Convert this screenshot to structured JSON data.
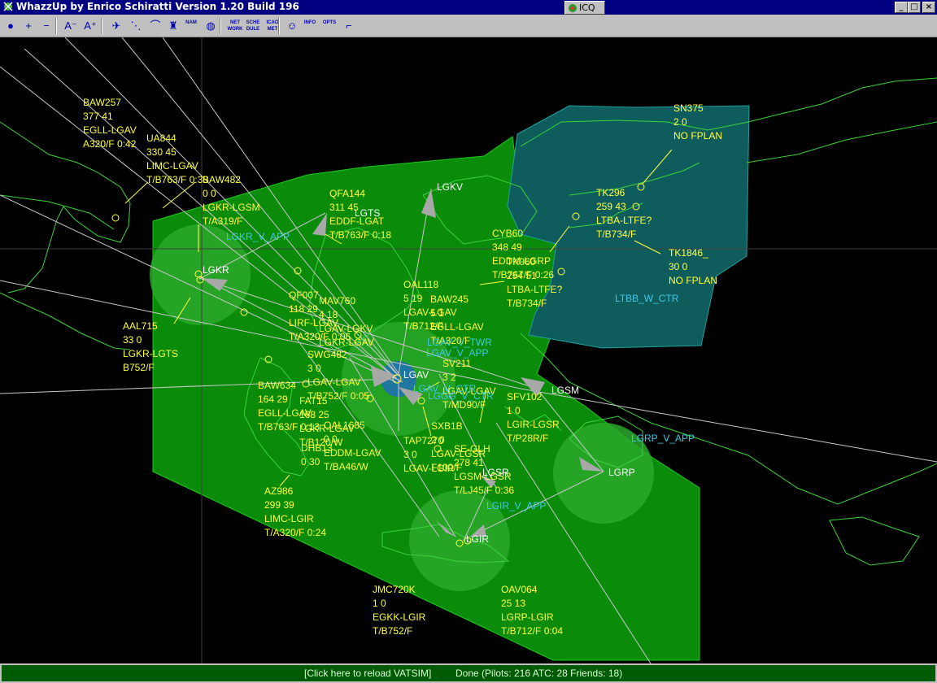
{
  "window": {
    "title": "WhazzUp by Enrico Schiratti Version 1.20 Build 196",
    "icq_label": "ICQ"
  },
  "toolbar": {
    "buttons": [
      {
        "name": "globe-icon",
        "glyph": "●"
      },
      {
        "name": "zoom-in-icon",
        "glyph": "+"
      },
      {
        "name": "zoom-out-icon",
        "glyph": "−"
      },
      {
        "name": "font-smaller-icon",
        "glyph": "A⁻"
      },
      {
        "name": "font-larger-icon",
        "glyph": "A⁺"
      },
      {
        "name": "aircraft-icon",
        "glyph": "✈"
      },
      {
        "name": "dotted-path-icon",
        "glyph": "⋱"
      },
      {
        "name": "route-line-icon",
        "glyph": "⌒"
      },
      {
        "name": "tower-icon",
        "glyph": "♜"
      },
      {
        "name": "nam-label",
        "glyph": "NAM"
      },
      {
        "name": "world-icon",
        "glyph": "◍"
      },
      {
        "name": "network-button",
        "glyph": "NET WORK"
      },
      {
        "name": "schedule-button",
        "glyph": "SCHE DULE"
      },
      {
        "name": "icao-met-button",
        "glyph": "ICAO MET"
      },
      {
        "name": "friends-smiley-icon",
        "glyph": "☺"
      },
      {
        "name": "info-button",
        "glyph": "INFO"
      },
      {
        "name": "options-button",
        "glyph": "OPTS"
      },
      {
        "name": "measure-tool-icon",
        "glyph": "⌐"
      }
    ]
  },
  "flights": [
    {
      "lines": [
        "BAW257",
        "377 41",
        "EGLL-LGAV",
        "A320/F 0:42"
      ]
    },
    {
      "lines": [
        "UA844",
        "330 45",
        "LIMC-LGAV",
        "T/B763/F 0:30"
      ]
    },
    {
      "lines": [
        "BAW482",
        "0 0",
        "LGKR-LGSM",
        "T/A319/F"
      ]
    },
    {
      "lines": [
        "QFA144",
        "311 45",
        "EDDF-LGAT",
        "T/B763/F 0:18"
      ]
    },
    {
      "lines": [
        "SN375",
        "2 0",
        "NO FPLAN"
      ]
    },
    {
      "lines": [
        "TK296",
        "259 43",
        "LTBA-LTFE?",
        "T/B734/F"
      ]
    },
    {
      "lines": [
        "TK1846_",
        "30 0",
        "NO FPLAN"
      ]
    },
    {
      "lines": [
        "CYB60",
        "348 49",
        "EDDM-LGRP",
        "T/B767/F 0:26"
      ]
    },
    {
      "lines": [
        "TK060",
        "254 51",
        "LTBA-LTFE?",
        "T/B734/F"
      ]
    },
    {
      "lines": [
        "OAL118",
        "5 19",
        "LGAV-LGAV",
        "T/B712/F"
      ]
    },
    {
      "lines": [
        "BAW245",
        "5 1",
        "EGLL-LGAV",
        "T/A320/F"
      ]
    },
    {
      "lines": [
        "QF007",
        "118 29",
        "LIRF-LGAV",
        "T/A320/F 0:06"
      ]
    },
    {
      "lines": [
        "MAV760",
        "4 18",
        "LGAV-LGKV",
        "LGKR-LGAV"
      ]
    },
    {
      "lines": [
        "SWG482",
        "3 0",
        "LGAV-LGAV",
        "T/B752/F 0:05"
      ]
    },
    {
      "lines": [
        "AAL715",
        "33 0",
        "LGKR-LGTS",
        "B752/F"
      ]
    },
    {
      "lines": [
        "BAW634",
        "164 29",
        "EGLL-LGAV",
        "T/B763/F 0:13"
      ]
    },
    {
      "lines": [
        "FAT15",
        "168 25",
        "LGKR-LGAV",
        "T/B120/W"
      ]
    },
    {
      "lines": [
        "OAL1685",
        "0 0",
        "EDDM-LGAV",
        "T/BA46/W"
      ]
    },
    {
      "lines": [
        "DHB13",
        "0 30"
      ]
    },
    {
      "lines": [
        "SV211",
        "3 2",
        "LGAV-LGAV",
        "T/MD90/F"
      ]
    },
    {
      "lines": [
        "SFV102",
        "1 0",
        "LGIR-LGSR",
        "T/P28R/F"
      ]
    },
    {
      "lines": [
        "SXB1B",
        "2 0",
        "LGAV-LGSR",
        "F100/F"
      ]
    },
    {
      "lines": [
        "TAP7270",
        "3 0",
        "LGAV-LGIR"
      ]
    },
    {
      "lines": [
        "SE-GLH",
        "278 41",
        "LGSM-LGSR",
        "T/LJ45/F 0:36"
      ]
    },
    {
      "lines": [
        "AZ986",
        "299 39",
        "LIMC-LGIR",
        "T/A320/F 0:24"
      ]
    },
    {
      "lines": [
        "JMC720K",
        "1 0",
        "EGKK-LGIR",
        "T/B752/F"
      ]
    },
    {
      "lines": [
        "OAV064",
        "25 13",
        "LGRP-LGIR",
        "T/B712/F 0:04"
      ]
    }
  ],
  "airports": [
    "LGKV",
    "LGTS",
    "LGKR",
    "LGAV",
    "LGSM",
    "LGSR",
    "LGRP",
    "LGIR"
  ],
  "atc": [
    "LGKR_V_APP",
    "LTBB_W_CTR",
    "LGAV_V_TWR",
    "LGAV_V_APP",
    "LGAV_V_CTR",
    "LGGG_V_CTR",
    "LGRP_V_APP",
    "LGIR_V_APP"
  ],
  "statusbar": {
    "reload": "[Click here to reload VATSIM]",
    "status": "Done (Pilots: 216  ATC: 28  Friends: 18)"
  },
  "colors": {
    "background": "#000000",
    "coast": "#3cd23c",
    "ctr_sector": "#0a8c0a",
    "approach": "#2aa82a",
    "ltbb_sector": "#0f5c5c",
    "flight_label": "#ffff40",
    "atc_label": "#40c8e8",
    "airport_label": "#ffffff"
  }
}
